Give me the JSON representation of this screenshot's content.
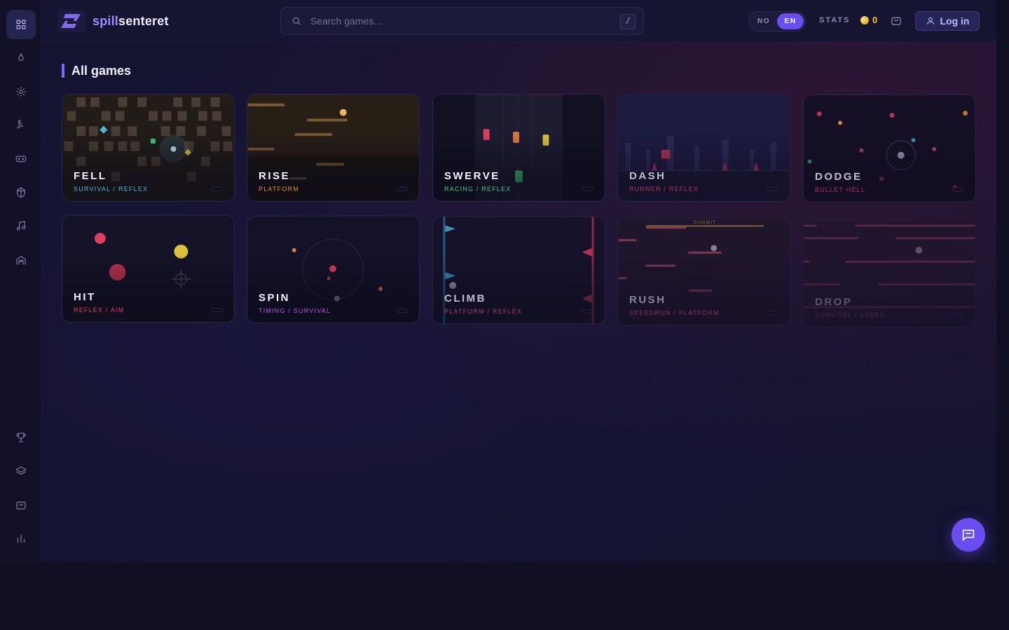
{
  "brand": {
    "name_accent": "spill",
    "name_rest": "senteret"
  },
  "search": {
    "placeholder": "Search games...",
    "shortcut": "/"
  },
  "language": {
    "options": [
      "NO",
      "EN"
    ],
    "selected": "EN"
  },
  "header": {
    "stats_label": "STATS",
    "coins": "0",
    "login_label": "Log in"
  },
  "sidebar": {
    "items": [
      {
        "icon": "grid-icon",
        "active": true
      },
      {
        "icon": "flame-icon"
      },
      {
        "icon": "sparkle-icon"
      },
      {
        "icon": "runner-icon"
      },
      {
        "icon": "gamepad-icon"
      },
      {
        "icon": "gem-icon"
      },
      {
        "icon": "music-icon"
      },
      {
        "icon": "building-icon"
      }
    ],
    "bottom_items": [
      {
        "icon": "trophy-icon"
      },
      {
        "icon": "layers-icon"
      },
      {
        "icon": "bag-icon"
      },
      {
        "icon": "bar-chart-icon"
      }
    ]
  },
  "section": {
    "title": "All games"
  },
  "games": [
    {
      "name": "FELL",
      "tags": "SURVIVAL / REFLEX",
      "tag_color": "#4fb6d9"
    },
    {
      "name": "RISE",
      "tags": "PLATFORM",
      "tag_color": "#d9913f"
    },
    {
      "name": "SWERVE",
      "tags": "RACING / REFLEX",
      "tag_color": "#3fcf7a"
    },
    {
      "name": "DASH",
      "tags": "RUNNER / REFLEX",
      "tag_color": "#e0405f"
    },
    {
      "name": "DODGE",
      "tags": "BULLET HELL",
      "tag_color": "#e0405f"
    },
    {
      "name": "HIT",
      "tags": "REFLEX / AIM",
      "tag_color": "#e0405f"
    },
    {
      "name": "SPIN",
      "tags": "TIMING / SURVIVAL",
      "tag_color": "#b35ad9"
    },
    {
      "name": "CLIMB",
      "tags": "PLATFORM / REFLEX",
      "tag_color": "#d94f7a"
    },
    {
      "name": "RUSH",
      "tags": "SPEEDRUN / PLATFORM",
      "tag_color": "#e05a6a"
    },
    {
      "name": "DROP",
      "tags": "SURVIVAL / SPEED",
      "tag_color": "#c04a5f"
    }
  ],
  "rush_art_label": "SUMMIT",
  "colors": {
    "accent": "#6a4df0",
    "coin": "#f4c531"
  }
}
